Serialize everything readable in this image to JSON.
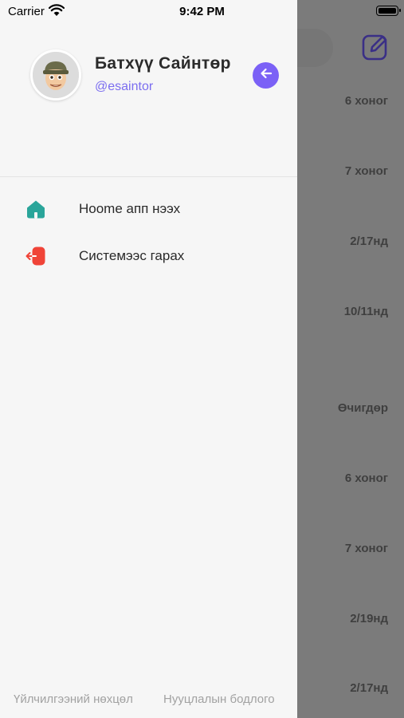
{
  "status_bar": {
    "carrier": "Carrier",
    "time": "9:42 PM"
  },
  "background_list": {
    "dates": [
      "6 хоног",
      "7 хоног",
      "2/17нд",
      "10/11нд",
      "Өчигдөр",
      "6 хоног",
      "7 хоног",
      "2/19нд",
      "2/17нд"
    ]
  },
  "drawer": {
    "profile": {
      "name": "Батхүү Сайнтөр",
      "username": "@esaintor"
    },
    "menu": [
      {
        "label": "Hoome апп нээх",
        "icon": "home-icon",
        "color": "#2aa59a"
      },
      {
        "label": "Системээс гарах",
        "icon": "logout-icon",
        "color": "#f04438"
      }
    ],
    "footer": {
      "terms": "Үйлчилгээний нөхцөл",
      "privacy": "Нууцлалын бодлого"
    }
  },
  "colors": {
    "accent": "#7b61f6",
    "drawer_bg": "#f6f6f6",
    "overlay": "#7b7b7b"
  }
}
